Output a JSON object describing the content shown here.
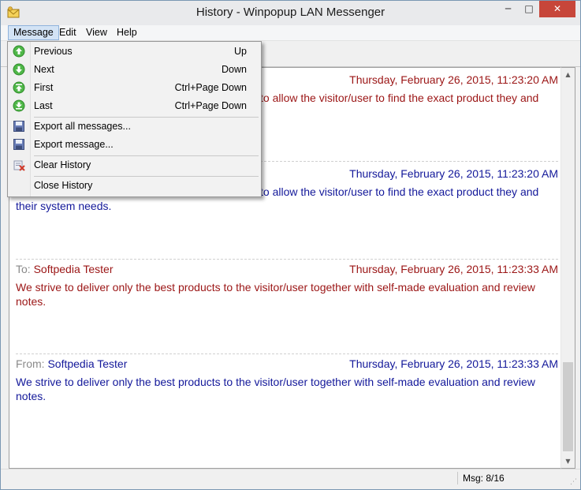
{
  "window": {
    "title": "History - Winpopup LAN Messenger"
  },
  "controls": {
    "minimize": "─",
    "maximize": "□",
    "close": "✕"
  },
  "menubar": [
    {
      "label": "Message",
      "active": true
    },
    {
      "label": "Edit"
    },
    {
      "label": "View"
    },
    {
      "label": "Help"
    }
  ],
  "menu": {
    "previous": {
      "label": "Previous",
      "shortcut": "Up",
      "icon": "arrow-up-circle-icon"
    },
    "next": {
      "label": "Next",
      "shortcut": "Down",
      "icon": "arrow-down-circle-icon"
    },
    "first": {
      "label": "First",
      "shortcut": "Ctrl+Page Down",
      "icon": "arrow-first-circle-icon"
    },
    "last": {
      "label": "Last",
      "shortcut": "Ctrl+Page Down",
      "icon": "arrow-last-circle-icon"
    },
    "export_all": {
      "label": "Export all messages...",
      "icon": "floppy-disk-icon"
    },
    "export_one": {
      "label": "Export message...",
      "icon": "floppy-disk-icon"
    },
    "clear": {
      "label": "Clear History",
      "icon": "clear-history-icon"
    },
    "close": {
      "label": "Close History"
    }
  },
  "messages": [
    {
      "time": "Thursday, February 26, 2015, 11:23:20 AM",
      "body": "to allow the visitor/user to find the exact product they and"
    },
    {
      "time": "Thursday, February 26, 2015, 11:23:20 AM",
      "body_line1": "to allow the visitor/user to find the exact product they and",
      "body_line2": "their system needs."
    },
    {
      "prefix": "To: ",
      "name": "Softpedia Tester",
      "time": "Thursday, February 26, 2015, 11:23:33 AM",
      "body": "We strive to deliver only the best products to the visitor/user together with self-made evaluation and review notes."
    },
    {
      "prefix": "From: ",
      "name": "Softpedia Tester",
      "time": "Thursday, February 26, 2015, 11:23:33 AM",
      "body": "We strive to deliver only the best products to the visitor/user together with self-made evaluation and review notes."
    }
  ],
  "status": {
    "text": "Msg: 8/16"
  },
  "colors": {
    "sent": "#9b1515",
    "received": "#13189a",
    "close_button": "#c7463a"
  }
}
